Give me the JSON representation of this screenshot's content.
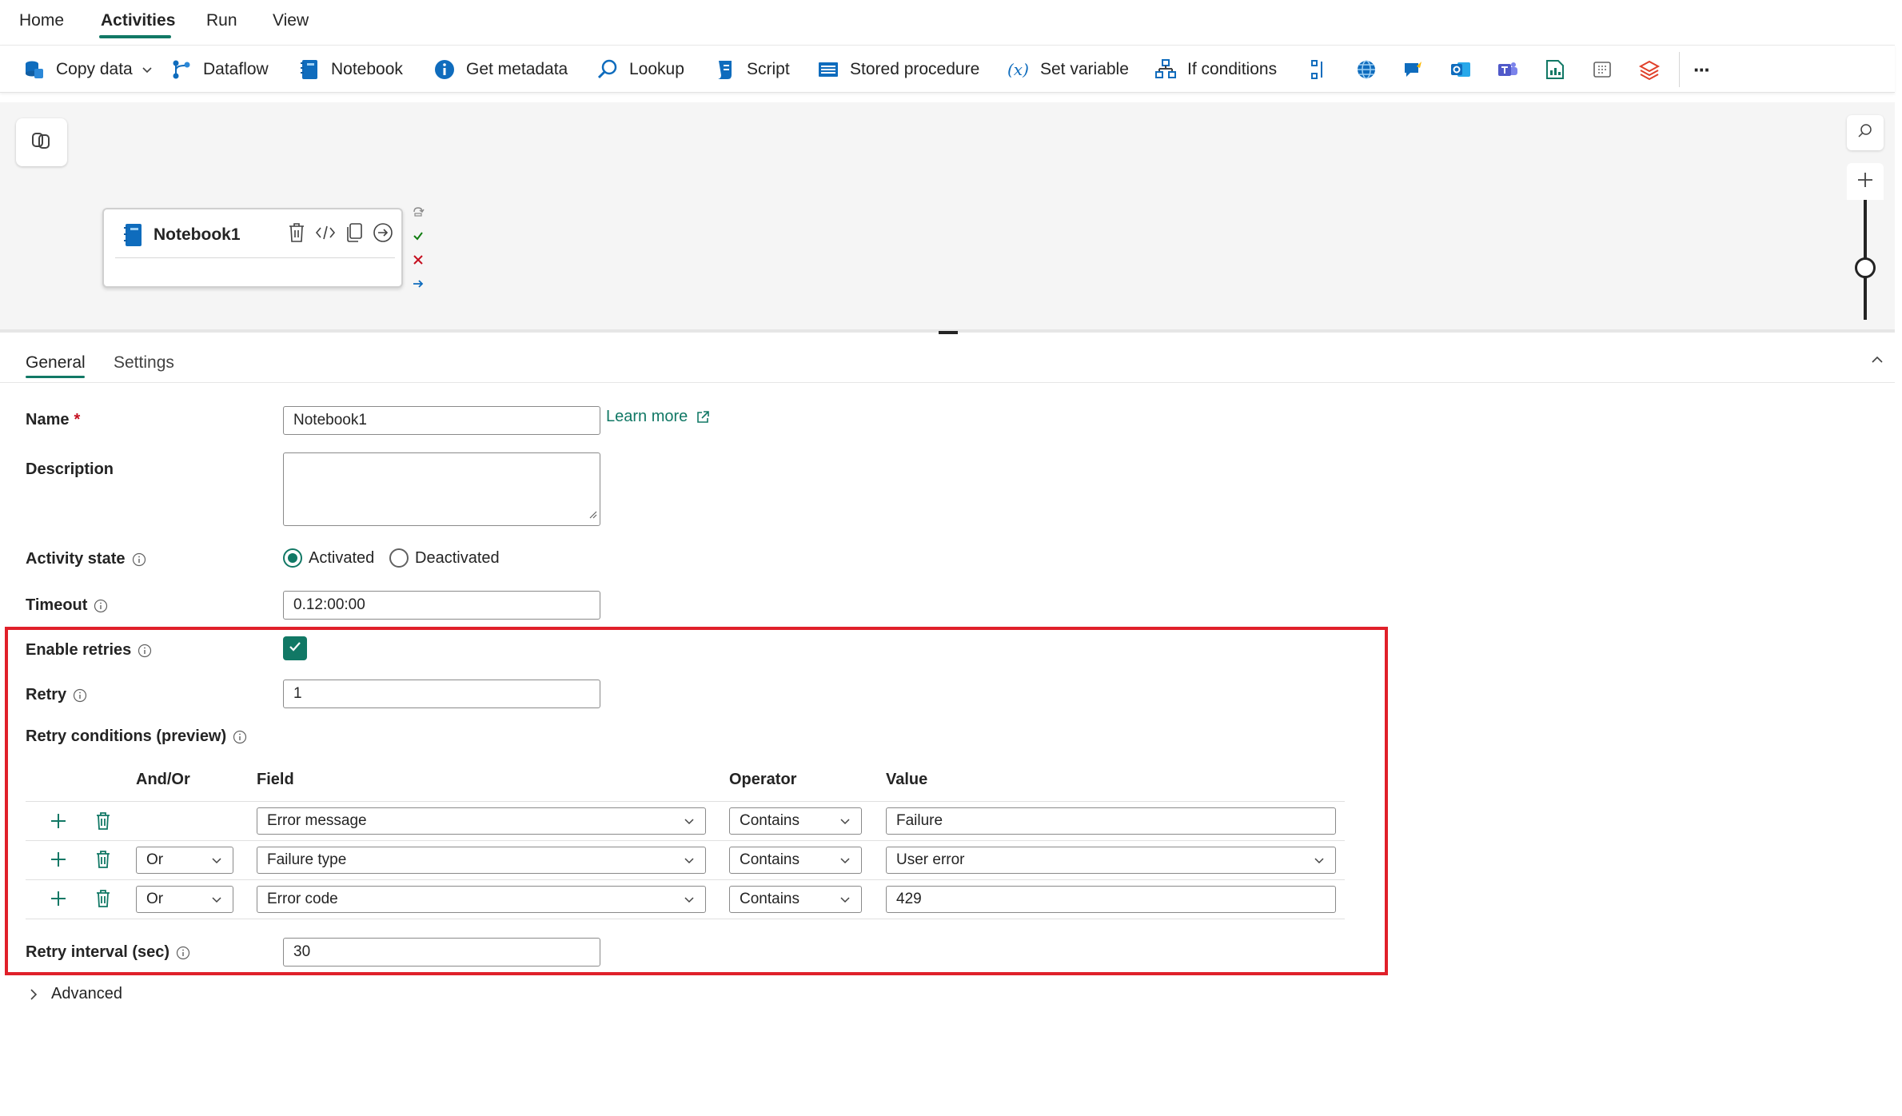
{
  "menu": {
    "items": [
      "Home",
      "Activities",
      "Run",
      "View"
    ],
    "active": "Activities"
  },
  "toolbar": {
    "copy_data": "Copy data",
    "dataflow": "Dataflow",
    "notebook": "Notebook",
    "get_metadata": "Get metadata",
    "lookup": "Lookup",
    "script": "Script",
    "stored_procedure": "Stored procedure",
    "set_variable": "Set variable",
    "if_conditions": "If conditions",
    "more": "···"
  },
  "canvas": {
    "node_title": "Notebook1"
  },
  "panel": {
    "tabs": [
      "General",
      "Settings"
    ],
    "active_tab": "General",
    "learn_more": "Learn more",
    "fields": {
      "name_label": "Name",
      "name_required": "*",
      "name_value": "Notebook1",
      "description_label": "Description",
      "description_value": "",
      "activity_state_label": "Activity state",
      "activated": "Activated",
      "deactivated": "Deactivated",
      "activity_state_selected": "Activated",
      "timeout_label": "Timeout",
      "timeout_value": "0.12:00:00",
      "enable_retries_label": "Enable retries",
      "enable_retries_checked": true,
      "retry_label": "Retry",
      "retry_value": "1",
      "retry_conditions_label": "Retry conditions (preview)",
      "retry_interval_label": "Retry interval (sec)",
      "retry_interval_value": "30"
    },
    "conditions": {
      "headers": {
        "and_or": "And/Or",
        "field": "Field",
        "operator": "Operator",
        "value": "Value"
      },
      "rows": [
        {
          "and_or": "",
          "field": "Error message",
          "operator": "Contains",
          "value": "Failure"
        },
        {
          "and_or": "Or",
          "field": "Failure type",
          "operator": "Contains",
          "value": "User error"
        },
        {
          "and_or": "Or",
          "field": "Error code",
          "operator": "Contains",
          "value": "429"
        }
      ]
    },
    "advanced": "Advanced"
  },
  "colors": {
    "accent": "#117865",
    "highlight": "#e0202a",
    "link": "#117865"
  }
}
